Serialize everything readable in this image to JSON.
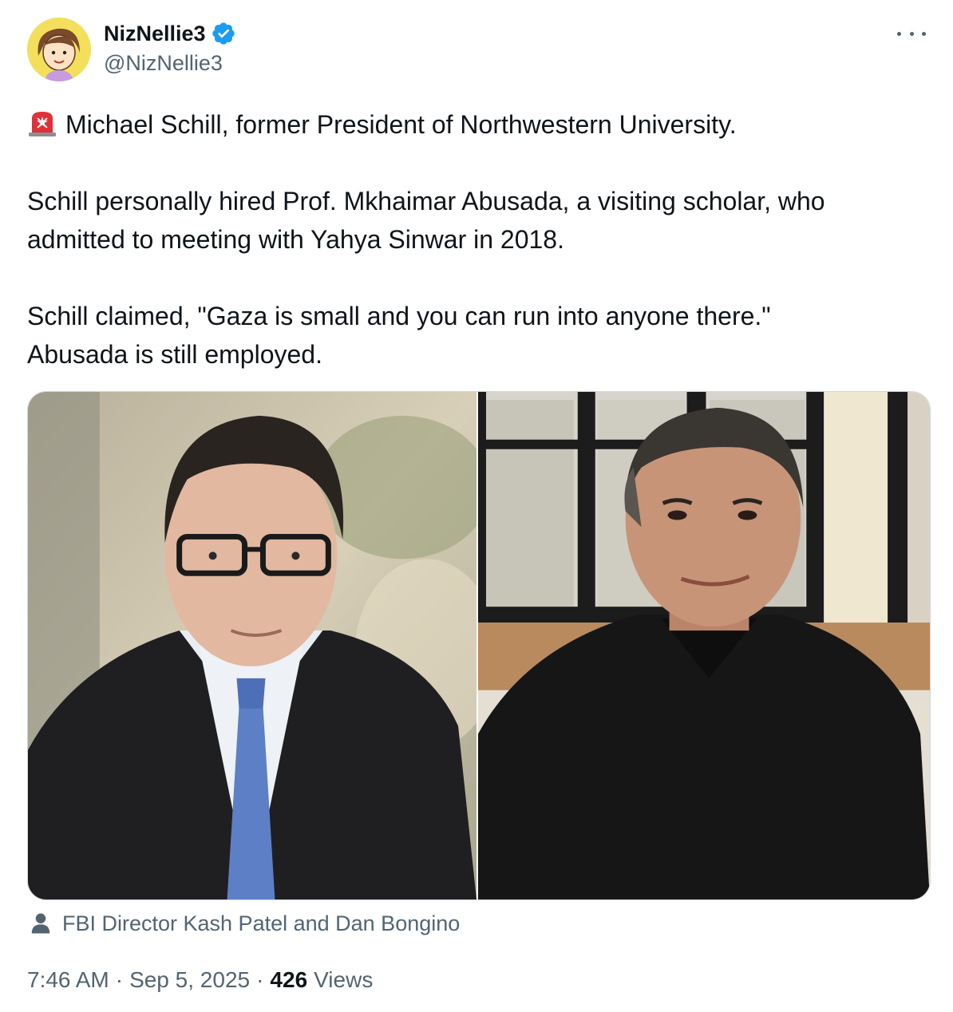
{
  "author": {
    "display_name": "NizNellie3",
    "handle": "@NizNellie3",
    "verified": true,
    "avatar_icon": "cartoon-girl-avatar",
    "verified_color": "#1d9bf0"
  },
  "more_icon": "more-horizontal-icon",
  "tweet": {
    "emoji": "siren-emoji",
    "line1": "Michael Schill, former President of Northwestern University.",
    "paragraph2": "Schill personally hired Prof. Mkhaimar Abusada, a visiting scholar, who admitted to meeting with Yahya Sinwar in 2018.",
    "paragraph3_line1": "Schill claimed, \"Gaza is small and you can run into anyone there.\"",
    "paragraph3_line2": "Abusada is still employed."
  },
  "media": {
    "photos": [
      {
        "name": "photo-man-in-suit-glasses"
      },
      {
        "name": "photo-man-in-black-shirt"
      }
    ]
  },
  "tagged": {
    "icon": "person-icon",
    "text": "FBI Director Kash Patel and Dan Bongino"
  },
  "meta": {
    "time": "7:46 AM",
    "date": "Sep 5, 2025",
    "views_count": "426",
    "views_label": "Views",
    "separator": "·"
  },
  "colors": {
    "text_primary": "#0f1419",
    "text_secondary": "#536471",
    "border": "#cfd9de",
    "accent": "#1d9bf0"
  }
}
